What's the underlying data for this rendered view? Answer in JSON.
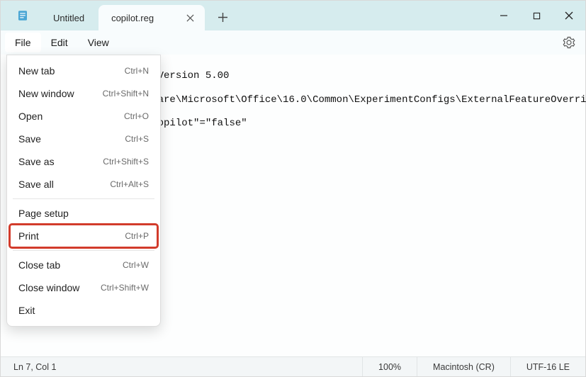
{
  "titlebar": {
    "tabs": [
      {
        "label": "Untitled",
        "active": false
      },
      {
        "label": "copilot.reg",
        "active": true
      }
    ]
  },
  "menubar": {
    "items": [
      "File",
      "Edit",
      "View"
    ]
  },
  "file_menu": {
    "new_tab": {
      "label": "New tab",
      "shortcut": "Ctrl+N"
    },
    "new_window": {
      "label": "New window",
      "shortcut": "Ctrl+Shift+N"
    },
    "open": {
      "label": "Open",
      "shortcut": "Ctrl+O"
    },
    "save": {
      "label": "Save",
      "shortcut": "Ctrl+S"
    },
    "save_as": {
      "label": "Save as",
      "shortcut": "Ctrl+Shift+S"
    },
    "save_all": {
      "label": "Save all",
      "shortcut": "Ctrl+Alt+S"
    },
    "page_setup": {
      "label": "Page setup",
      "shortcut": ""
    },
    "print": {
      "label": "Print",
      "shortcut": "Ctrl+P"
    },
    "close_tab": {
      "label": "Close tab",
      "shortcut": "Ctrl+W"
    },
    "close_window": {
      "label": "Close window",
      "shortcut": "Ctrl+Shift+W"
    },
    "exit": {
      "label": "Exit",
      "shortcut": ""
    }
  },
  "editor": {
    "content": "Windows Registry Editor Version 5.00\n[HKEY_CURRENT_USER\\Software\\Microsoft\\Office\\16.0\\Common\\ExperimentConfigs\\ExternalFeatureOverrides\n\"Microsoft.Office.Word.Copilot\"=\"false\""
  },
  "statusbar": {
    "position": "Ln 7, Col 1",
    "zoom": "100%",
    "line_ending": "Macintosh (CR)",
    "encoding": "UTF-16 LE"
  }
}
